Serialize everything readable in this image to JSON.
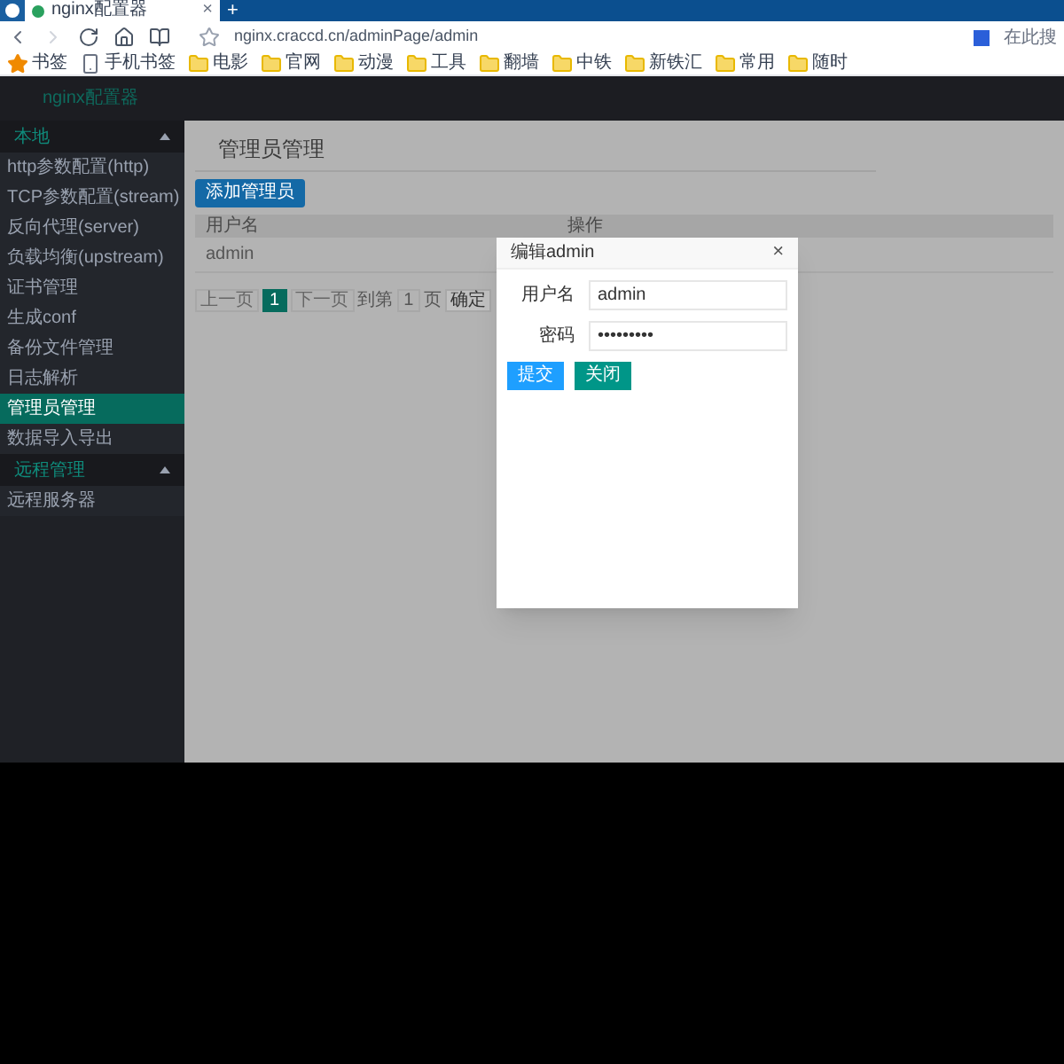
{
  "browser": {
    "tab": {
      "title": "nginx配置器",
      "close": "×"
    },
    "new_tab": "+",
    "url": "nginx.craccd.cn/adminPage/admin",
    "search_hint": "在此搜",
    "bookmarks": [
      {
        "label": "书签",
        "kind": "star"
      },
      {
        "label": "手机书签",
        "kind": "phone"
      },
      {
        "label": "电影",
        "kind": "folder"
      },
      {
        "label": "官网",
        "kind": "folder"
      },
      {
        "label": "动漫",
        "kind": "folder"
      },
      {
        "label": "工具",
        "kind": "folder"
      },
      {
        "label": "翻墙",
        "kind": "folder"
      },
      {
        "label": "中铁",
        "kind": "folder"
      },
      {
        "label": "新铁汇",
        "kind": "folder"
      },
      {
        "label": "常用",
        "kind": "folder"
      },
      {
        "label": "随时",
        "kind": "folder"
      }
    ]
  },
  "app": {
    "title": "nginx配置器"
  },
  "sidebar": {
    "groups": [
      {
        "label": "本地",
        "expanded": true,
        "children": [
          {
            "label": "http参数配置(http)",
            "selected": false
          },
          {
            "label": "TCP参数配置(stream)",
            "selected": false
          },
          {
            "label": "反向代理(server)",
            "selected": false
          },
          {
            "label": "负载均衡(upstream)",
            "selected": false
          },
          {
            "label": "证书管理",
            "selected": false
          },
          {
            "label": "生成conf",
            "selected": false
          },
          {
            "label": "备份文件管理",
            "selected": false
          },
          {
            "label": "日志解析",
            "selected": false
          },
          {
            "label": "管理员管理",
            "selected": true
          },
          {
            "label": "数据导入导出",
            "selected": false
          }
        ]
      },
      {
        "label": "远程管理",
        "expanded": true,
        "children": [
          {
            "label": "远程服务器",
            "selected": false
          }
        ]
      }
    ]
  },
  "page": {
    "title": "管理员管理",
    "add_button": "添加管理员",
    "table": {
      "columns": [
        "用户名",
        "操作"
      ],
      "rows": [
        [
          "admin"
        ]
      ]
    },
    "pagination": {
      "prev": "上一页",
      "pages": [
        {
          "label": "1",
          "selected": true
        }
      ],
      "next": "下一页",
      "goto_label": "到第",
      "goto_value": "1",
      "page_suffix": "页",
      "confirm": "确定"
    }
  },
  "dialog": {
    "title": "编辑admin",
    "close": "×",
    "fields": [
      {
        "label": "用户名",
        "value": "admin"
      },
      {
        "label": "密码",
        "value": "•••••••••"
      }
    ],
    "buttons": [
      {
        "label": "提交",
        "kind": "primary"
      },
      {
        "label": "关闭",
        "kind": "secondary"
      }
    ]
  }
}
